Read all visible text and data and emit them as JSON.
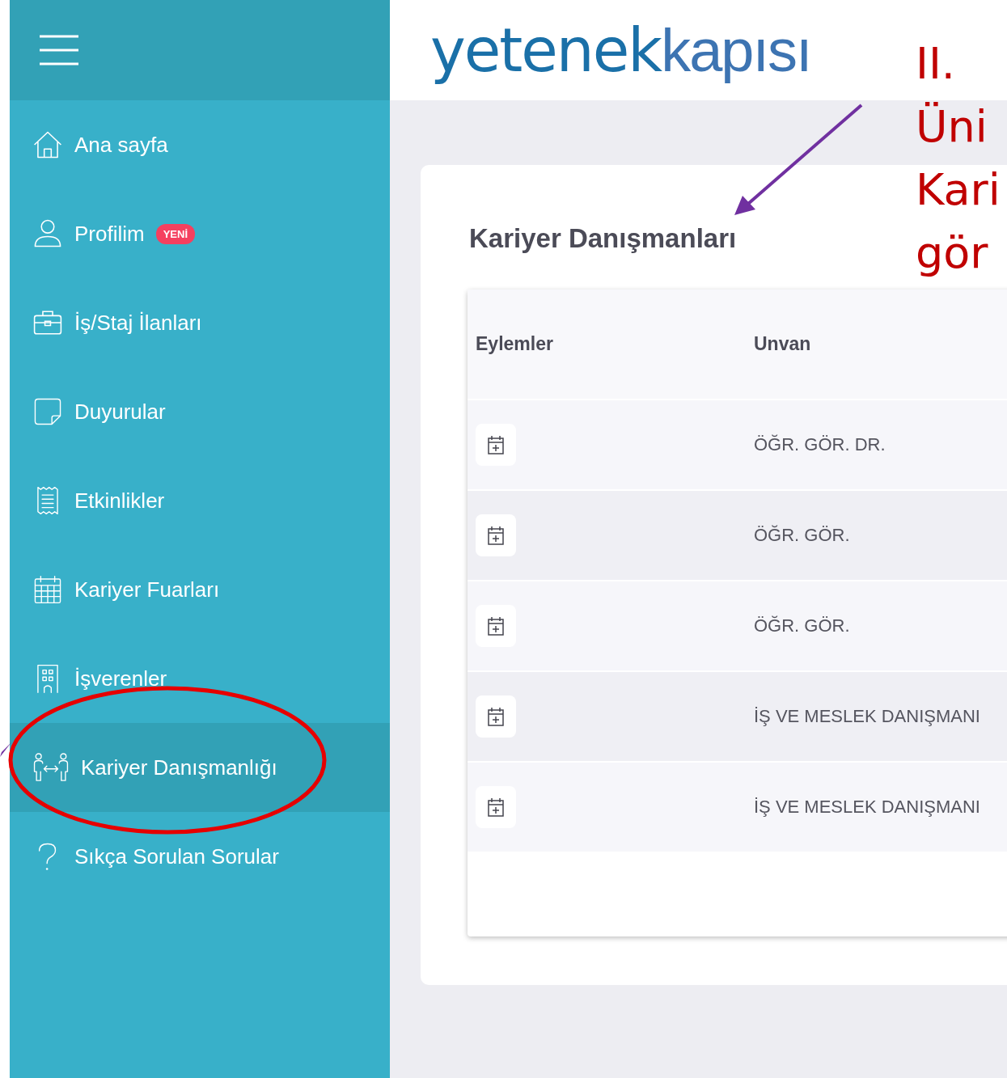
{
  "header": {
    "logo": {
      "bold": "yetenek",
      "light": "kapısı"
    }
  },
  "sidebar": {
    "items": [
      {
        "label": "Ana sayfa",
        "kind": "home",
        "selected": false
      },
      {
        "label": "Profilim",
        "kind": "user",
        "badge": "YENİ",
        "selected": false
      },
      {
        "label": "İş/Staj İlanları",
        "kind": "briefcase",
        "selected": false
      },
      {
        "label": "Duyurular",
        "kind": "note",
        "selected": false
      },
      {
        "label": "Etkinlikler",
        "kind": "receipt",
        "selected": false
      },
      {
        "label": "Kariyer Fuarları",
        "kind": "calendar",
        "selected": false
      },
      {
        "label": "İşverenler",
        "kind": "building",
        "selected": false
      },
      {
        "label": "Kariyer Danışmanlığı",
        "kind": "people",
        "selected": true
      },
      {
        "label": "Sıkça Sorulan Sorular",
        "kind": "question",
        "selected": false
      }
    ]
  },
  "content": {
    "title": "Kariyer Danışmanları",
    "table": {
      "columns": [
        "Eylemler",
        "Unvan"
      ],
      "rows": [
        {
          "unvan": "ÖĞR. GÖR. DR."
        },
        {
          "unvan": "ÖĞR. GÖR."
        },
        {
          "unvan": "ÖĞR. GÖR."
        },
        {
          "unvan": "İŞ VE MESLEK DANIŞMANI"
        },
        {
          "unvan": "İŞ VE MESLEK DANIŞMANI"
        }
      ]
    }
  },
  "annotation": {
    "lines": [
      "II.",
      "Üni",
      "Kari",
      "gör"
    ]
  }
}
